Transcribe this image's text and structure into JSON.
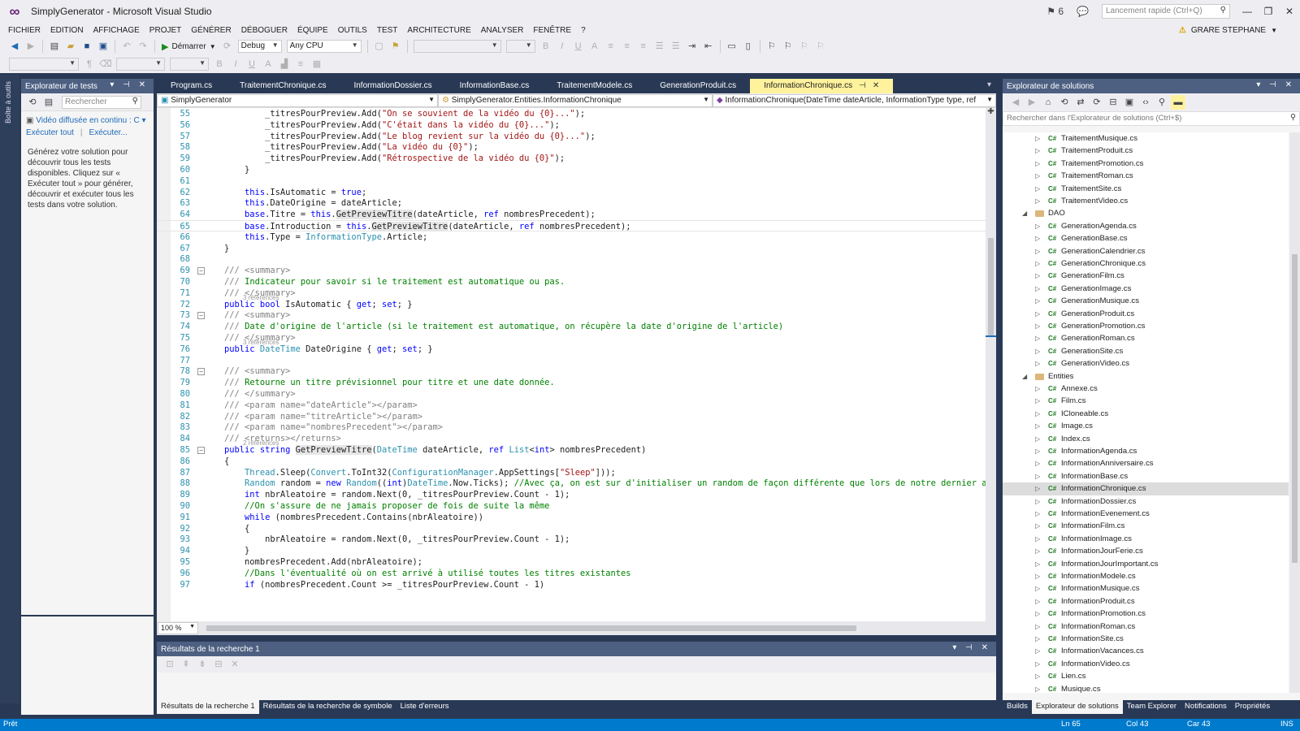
{
  "window": {
    "title": "SimplyGenerator - Microsoft Visual Studio",
    "notif_count": "6",
    "quick_launch_placeholder": "Lancement rapide (Ctrl+Q)"
  },
  "menu": [
    "FICHIER",
    "EDITION",
    "AFFICHAGE",
    "PROJET",
    "GÉNÉRER",
    "DÉBOGUER",
    "ÉQUIPE",
    "OUTILS",
    "TEST",
    "ARCHITECTURE",
    "ANALYSER",
    "FENÊTRE",
    "?"
  ],
  "user": "GRARE STEPHANE",
  "toolbar": {
    "start_label": "Démarrer",
    "config": "Debug",
    "platform": "Any CPU"
  },
  "left_strip_label": "Boîte à outils",
  "test_explorer": {
    "title": "Explorateur de tests",
    "search_placeholder": "Rechercher",
    "filter": "Vidéo diffusée en continu : C",
    "run_all": "Exécuter tout",
    "run": "Exécuter...",
    "message": "Générez votre solution pour découvrir tous les tests disponibles. Cliquez sur « Exécuter tout » pour générer, découvrir et exécuter tous les tests dans votre solution."
  },
  "editor": {
    "tabs": [
      "Program.cs",
      "TraitementChronique.cs",
      "InformationDossier.cs",
      "InformationBase.cs",
      "TraitementModele.cs",
      "GenerationProduit.cs",
      "InformationChronique.cs"
    ],
    "active_tab_index": 6,
    "nav_project": "SimplyGenerator",
    "nav_class": "SimplyGenerator.Entities.InformationChronique",
    "nav_member": "InformationChronique(DateTime dateArticle, InformationType type, ref",
    "zoom": "100 %"
  },
  "code_lines": [
    {
      "n": "55",
      "t": [
        [
          "            _titresPourPreview.Add(",
          ""
        ],
        [
          "\"On se souvient de la vidéo du {0}...\"",
          "st"
        ],
        [
          ");",
          ""
        ]
      ]
    },
    {
      "n": "56",
      "t": [
        [
          "            _titresPourPreview.Add(",
          ""
        ],
        [
          "\"C'était dans la vidéo du {0}...\"",
          "st"
        ],
        [
          ");",
          ""
        ]
      ]
    },
    {
      "n": "57",
      "t": [
        [
          "            _titresPourPreview.Add(",
          ""
        ],
        [
          "\"Le blog revient sur la vidéo du {0}...\"",
          "st"
        ],
        [
          ");",
          ""
        ]
      ]
    },
    {
      "n": "58",
      "t": [
        [
          "            _titresPourPreview.Add(",
          ""
        ],
        [
          "\"La vidéo du {0}\"",
          "st"
        ],
        [
          ");",
          ""
        ]
      ]
    },
    {
      "n": "59",
      "t": [
        [
          "            _titresPourPreview.Add(",
          ""
        ],
        [
          "\"Rétrospective de la vidéo du {0}\"",
          "st"
        ],
        [
          ");",
          ""
        ]
      ]
    },
    {
      "n": "60",
      "t": [
        [
          "        }",
          ""
        ]
      ]
    },
    {
      "n": "61",
      "t": [
        [
          "",
          ""
        ]
      ]
    },
    {
      "n": "62",
      "t": [
        [
          "        ",
          ""
        ],
        [
          "this",
          "kw"
        ],
        [
          ".IsAutomatic = ",
          ""
        ],
        [
          "true",
          "kw"
        ],
        [
          ";",
          ""
        ]
      ]
    },
    {
      "n": "63",
      "t": [
        [
          "        ",
          ""
        ],
        [
          "this",
          "kw"
        ],
        [
          ".DateOrigine = dateArticle;",
          ""
        ]
      ]
    },
    {
      "n": "64",
      "t": [
        [
          "        ",
          ""
        ],
        [
          "base",
          "kw"
        ],
        [
          ".Titre = ",
          ""
        ],
        [
          "this",
          "kw"
        ],
        [
          ".",
          ""
        ],
        [
          "GetPreviewTitre",
          "hl"
        ],
        [
          "(dateArticle, ",
          ""
        ],
        [
          "ref",
          "kw"
        ],
        [
          " nombresPrecedent);",
          ""
        ]
      ]
    },
    {
      "n": "65",
      "cur": true,
      "t": [
        [
          "        ",
          ""
        ],
        [
          "base",
          "kw"
        ],
        [
          ".Introduction = ",
          ""
        ],
        [
          "this",
          "kw"
        ],
        [
          ".",
          ""
        ],
        [
          "GetPreviewTitre",
          "hl"
        ],
        [
          "(dateArticle, ",
          ""
        ],
        [
          "ref",
          "kw"
        ],
        [
          " nombresPrecedent);",
          ""
        ]
      ]
    },
    {
      "n": "66",
      "t": [
        [
          "        ",
          ""
        ],
        [
          "this",
          "kw"
        ],
        [
          ".Type = ",
          ""
        ],
        [
          "InformationType",
          "ty"
        ],
        [
          ".Article;",
          ""
        ]
      ]
    },
    {
      "n": "67",
      "t": [
        [
          "    }",
          ""
        ]
      ]
    },
    {
      "n": "68",
      "t": [
        [
          "",
          ""
        ]
      ]
    },
    {
      "n": "69",
      "fold": true,
      "t": [
        [
          "    ",
          ""
        ],
        [
          "/// <summary>",
          "xd"
        ]
      ]
    },
    {
      "n": "70",
      "t": [
        [
          "    ",
          ""
        ],
        [
          "/// ",
          "xd"
        ],
        [
          "Indicateur pour savoir si le traitement est automatique ou pas.",
          "cm"
        ]
      ]
    },
    {
      "n": "71",
      "t": [
        [
          "    ",
          ""
        ],
        [
          "/// </summary>",
          "xd"
        ]
      ],
      "refs": "3 références"
    },
    {
      "n": "72",
      "t": [
        [
          "    ",
          ""
        ],
        [
          "public",
          "kw"
        ],
        [
          " ",
          ""
        ],
        [
          "bool",
          "kw"
        ],
        [
          " IsAutomatic { ",
          ""
        ],
        [
          "get",
          "kw"
        ],
        [
          "; ",
          ""
        ],
        [
          "set",
          "kw"
        ],
        [
          "; }",
          ""
        ]
      ]
    },
    {
      "n": "73",
      "fold": true,
      "t": [
        [
          "    ",
          ""
        ],
        [
          "/// <summary>",
          "xd"
        ]
      ]
    },
    {
      "n": "74",
      "t": [
        [
          "    ",
          ""
        ],
        [
          "/// ",
          "xd"
        ],
        [
          "Date d'origine de l'article (si le traitement est automatique, on récupère la date d'origine de l'article)",
          "cm"
        ]
      ]
    },
    {
      "n": "75",
      "t": [
        [
          "    ",
          ""
        ],
        [
          "/// </summary>",
          "xd"
        ]
      ],
      "refs": "3 références"
    },
    {
      "n": "76",
      "t": [
        [
          "    ",
          ""
        ],
        [
          "public",
          "kw"
        ],
        [
          " ",
          ""
        ],
        [
          "DateTime",
          "ty"
        ],
        [
          " DateOrigine { ",
          ""
        ],
        [
          "get",
          "kw"
        ],
        [
          "; ",
          ""
        ],
        [
          "set",
          "kw"
        ],
        [
          "; }",
          ""
        ]
      ]
    },
    {
      "n": "77",
      "t": [
        [
          "",
          ""
        ]
      ]
    },
    {
      "n": "78",
      "fold": true,
      "t": [
        [
          "    ",
          ""
        ],
        [
          "/// <summary>",
          "xd"
        ]
      ]
    },
    {
      "n": "79",
      "t": [
        [
          "    ",
          ""
        ],
        [
          "/// ",
          "xd"
        ],
        [
          "Retourne un titre prévisionnel pour titre et une date donnée.",
          "cm"
        ]
      ]
    },
    {
      "n": "80",
      "t": [
        [
          "    ",
          ""
        ],
        [
          "/// </summary>",
          "xd"
        ]
      ]
    },
    {
      "n": "81",
      "t": [
        [
          "    ",
          ""
        ],
        [
          "/// <param name=\"dateArticle\"></param>",
          "xd"
        ]
      ]
    },
    {
      "n": "82",
      "t": [
        [
          "    ",
          ""
        ],
        [
          "/// <param name=\"titreArticle\"></param>",
          "xd"
        ]
      ]
    },
    {
      "n": "83",
      "t": [
        [
          "    ",
          ""
        ],
        [
          "/// <param name=\"nombresPrecedent\"></param>",
          "xd"
        ]
      ]
    },
    {
      "n": "84",
      "t": [
        [
          "    ",
          ""
        ],
        [
          "/// <returns></returns>",
          "xd"
        ]
      ],
      "refs": "2 références"
    },
    {
      "n": "85",
      "fold": true,
      "t": [
        [
          "    ",
          ""
        ],
        [
          "public",
          "kw"
        ],
        [
          " ",
          ""
        ],
        [
          "string",
          "kw"
        ],
        [
          " ",
          ""
        ],
        [
          "GetPreviewTitre",
          "hl"
        ],
        [
          "(",
          ""
        ],
        [
          "DateTime",
          "ty"
        ],
        [
          " dateArticle, ",
          ""
        ],
        [
          "ref",
          "kw"
        ],
        [
          " ",
          ""
        ],
        [
          "List",
          "ty"
        ],
        [
          "<",
          ""
        ],
        [
          "int",
          "kw"
        ],
        [
          "> nombresPrecedent)",
          ""
        ]
      ]
    },
    {
      "n": "86",
      "t": [
        [
          "    {",
          ""
        ]
      ]
    },
    {
      "n": "87",
      "t": [
        [
          "        ",
          ""
        ],
        [
          "Thread",
          "ty"
        ],
        [
          ".Sleep(",
          ""
        ],
        [
          "Convert",
          "ty"
        ],
        [
          ".ToInt32(",
          ""
        ],
        [
          "ConfigurationManager",
          "ty"
        ],
        [
          ".AppSettings[",
          ""
        ],
        [
          "\"Sleep\"",
          "st"
        ],
        [
          "]));",
          ""
        ]
      ]
    },
    {
      "n": "88",
      "t": [
        [
          "        ",
          ""
        ],
        [
          "Random",
          "ty"
        ],
        [
          " random = ",
          ""
        ],
        [
          "new",
          "kw"
        ],
        [
          " ",
          ""
        ],
        [
          "Random",
          "ty"
        ],
        [
          "((",
          ""
        ],
        [
          "int",
          "kw"
        ],
        [
          ")",
          ""
        ],
        [
          "DateTime",
          "ty"
        ],
        [
          ".Now.Ticks); ",
          ""
        ],
        [
          "//Avec ça, on est sur d'initialiser un random de façon différente que lors de notre dernier appel.",
          "cm"
        ]
      ]
    },
    {
      "n": "89",
      "t": [
        [
          "        ",
          ""
        ],
        [
          "int",
          "kw"
        ],
        [
          " nbrAleatoire = random.Next(0, _titresPourPreview.Count - 1);",
          ""
        ]
      ]
    },
    {
      "n": "90",
      "t": [
        [
          "        ",
          ""
        ],
        [
          "//On s'assure de ne jamais proposer de fois de suite la même",
          "cm"
        ]
      ]
    },
    {
      "n": "91",
      "t": [
        [
          "        ",
          ""
        ],
        [
          "while",
          "kw"
        ],
        [
          " (nombresPrecedent.Contains(nbrAleatoire))",
          ""
        ]
      ]
    },
    {
      "n": "92",
      "t": [
        [
          "        {",
          ""
        ]
      ]
    },
    {
      "n": "93",
      "t": [
        [
          "            nbrAleatoire = random.Next(0, _titresPourPreview.Count - 1);",
          ""
        ]
      ]
    },
    {
      "n": "94",
      "t": [
        [
          "        }",
          ""
        ]
      ]
    },
    {
      "n": "95",
      "t": [
        [
          "        nombresPrecedent.Add(nbrAleatoire);",
          ""
        ]
      ]
    },
    {
      "n": "96",
      "t": [
        [
          "        ",
          ""
        ],
        [
          "//Dans l'éventualité où on est arrivé à utilisé toutes les titres existantes",
          "cm"
        ]
      ]
    },
    {
      "n": "97",
      "t": [
        [
          "        ",
          ""
        ],
        [
          "if",
          "kw"
        ],
        [
          " (nombresPrecedent.Count >= _titresPourPreview.Count - 1)",
          ""
        ]
      ]
    }
  ],
  "find_results": {
    "title": "Résultats de la recherche 1"
  },
  "bottom_tabs": [
    "Résultats de la recherche 1",
    "Résultats de la recherche de symbole",
    "Liste d'erreurs"
  ],
  "solution_explorer": {
    "title": "Explorateur de solutions",
    "search_placeholder": "Rechercher dans l'Explorateur de solutions (Ctrl+$)",
    "items": [
      {
        "label": "TraitementMusique.cs",
        "depth": 2,
        "kind": "cs"
      },
      {
        "label": "TraitementProduit.cs",
        "depth": 2,
        "kind": "cs"
      },
      {
        "label": "TraitementPromotion.cs",
        "depth": 2,
        "kind": "cs"
      },
      {
        "label": "TraitementRoman.cs",
        "depth": 2,
        "kind": "cs"
      },
      {
        "label": "TraitementSite.cs",
        "depth": 2,
        "kind": "cs"
      },
      {
        "label": "TraitementVideo.cs",
        "depth": 2,
        "kind": "cs"
      },
      {
        "label": "DAO",
        "depth": 1,
        "kind": "folder"
      },
      {
        "label": "GenerationAgenda.cs",
        "depth": 2,
        "kind": "cs"
      },
      {
        "label": "GenerationBase.cs",
        "depth": 2,
        "kind": "cs"
      },
      {
        "label": "GenerationCalendrier.cs",
        "depth": 2,
        "kind": "cs"
      },
      {
        "label": "GenerationChronique.cs",
        "depth": 2,
        "kind": "cs"
      },
      {
        "label": "GenerationFilm.cs",
        "depth": 2,
        "kind": "cs"
      },
      {
        "label": "GenerationImage.cs",
        "depth": 2,
        "kind": "cs"
      },
      {
        "label": "GenerationMusique.cs",
        "depth": 2,
        "kind": "cs"
      },
      {
        "label": "GenerationProduit.cs",
        "depth": 2,
        "kind": "cs"
      },
      {
        "label": "GenerationPromotion.cs",
        "depth": 2,
        "kind": "cs"
      },
      {
        "label": "GenerationRoman.cs",
        "depth": 2,
        "kind": "cs"
      },
      {
        "label": "GenerationSite.cs",
        "depth": 2,
        "kind": "cs"
      },
      {
        "label": "GenerationVideo.cs",
        "depth": 2,
        "kind": "cs"
      },
      {
        "label": "Entities",
        "depth": 1,
        "kind": "folder"
      },
      {
        "label": "Annexe.cs",
        "depth": 2,
        "kind": "cs"
      },
      {
        "label": "Film.cs",
        "depth": 2,
        "kind": "cs"
      },
      {
        "label": "ICloneable.cs",
        "depth": 2,
        "kind": "cs"
      },
      {
        "label": "Image.cs",
        "depth": 2,
        "kind": "cs"
      },
      {
        "label": "Index.cs",
        "depth": 2,
        "kind": "cs"
      },
      {
        "label": "InformationAgenda.cs",
        "depth": 2,
        "kind": "cs"
      },
      {
        "label": "InformationAnniversaire.cs",
        "depth": 2,
        "kind": "cs"
      },
      {
        "label": "InformationBase.cs",
        "depth": 2,
        "kind": "cs"
      },
      {
        "label": "InformationChronique.cs",
        "depth": 2,
        "kind": "cs",
        "selected": true
      },
      {
        "label": "InformationDossier.cs",
        "depth": 2,
        "kind": "cs"
      },
      {
        "label": "InformationEvenement.cs",
        "depth": 2,
        "kind": "cs"
      },
      {
        "label": "InformationFilm.cs",
        "depth": 2,
        "kind": "cs"
      },
      {
        "label": "InformationImage.cs",
        "depth": 2,
        "kind": "cs"
      },
      {
        "label": "InformationJourFerie.cs",
        "depth": 2,
        "kind": "cs"
      },
      {
        "label": "InformationJourImportant.cs",
        "depth": 2,
        "kind": "cs"
      },
      {
        "label": "InformationModele.cs",
        "depth": 2,
        "kind": "cs"
      },
      {
        "label": "InformationMusique.cs",
        "depth": 2,
        "kind": "cs"
      },
      {
        "label": "InformationProduit.cs",
        "depth": 2,
        "kind": "cs"
      },
      {
        "label": "InformationPromotion.cs",
        "depth": 2,
        "kind": "cs"
      },
      {
        "label": "InformationRoman.cs",
        "depth": 2,
        "kind": "cs"
      },
      {
        "label": "InformationSite.cs",
        "depth": 2,
        "kind": "cs"
      },
      {
        "label": "InformationVacances.cs",
        "depth": 2,
        "kind": "cs"
      },
      {
        "label": "InformationVideo.cs",
        "depth": 2,
        "kind": "cs"
      },
      {
        "label": "Lien.cs",
        "depth": 2,
        "kind": "cs"
      },
      {
        "label": "Musique.cs",
        "depth": 2,
        "kind": "cs"
      }
    ]
  },
  "right_tabs": [
    "Builds",
    "Explorateur de solutions",
    "Team Explorer",
    "Notifications",
    "Propriétés"
  ],
  "status": {
    "ready": "Prêt",
    "line": "Ln 65",
    "col": "Col 43",
    "car": "Car 43",
    "mode": "INS"
  },
  "colors": {
    "accent": "#007acc",
    "pane_header": "#4d6082",
    "active_tab": "#fff29d",
    "frame": "#293955"
  }
}
